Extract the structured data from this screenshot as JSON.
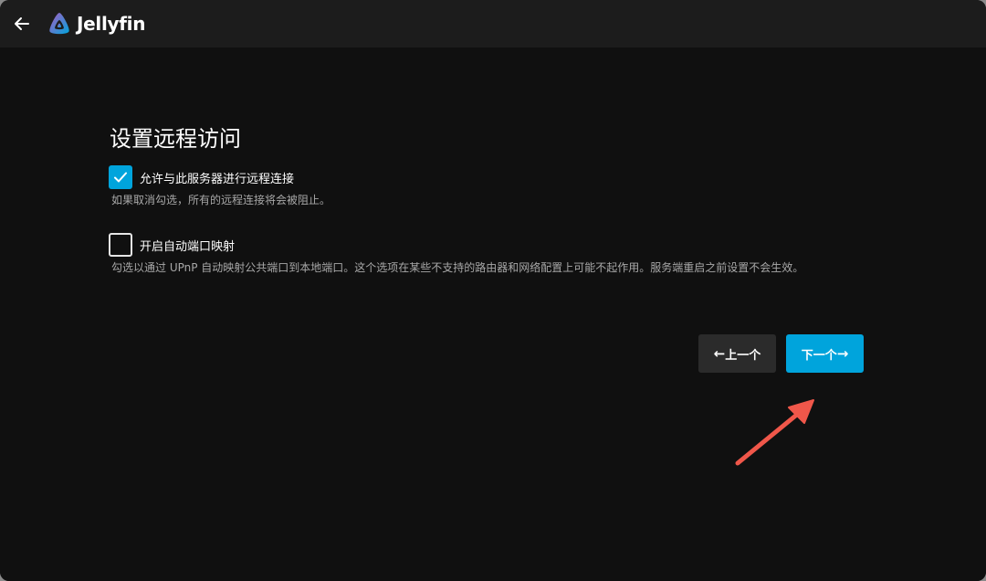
{
  "app": {
    "name": "Jellyfin"
  },
  "page": {
    "title": "设置远程访问"
  },
  "options": [
    {
      "label": "允许与此服务器进行远程连接",
      "checked": true,
      "description": "如果取消勾选，所有的远程连接将会被阻止。"
    },
    {
      "label": "开启自动端口映射",
      "checked": false,
      "description": "勾选以通过 UPnP 自动映射公共端口到本地端口。这个选项在某些不支持的路由器和网络配置上可能不起作用。服务端重启之前设置不会生效。"
    }
  ],
  "buttons": {
    "prev_label": "上一个",
    "next_label": "下一个"
  },
  "colors": {
    "accent": "#00a4dc",
    "annotation_arrow": "#f0574a",
    "background": "#101010",
    "header": "#1c1c1c"
  },
  "icons": {
    "back": "arrow-left-icon",
    "logo": "jellyfin-logo-icon",
    "check": "checkmark-icon",
    "prev": "arrow-left-icon",
    "next": "arrow-right-icon"
  }
}
